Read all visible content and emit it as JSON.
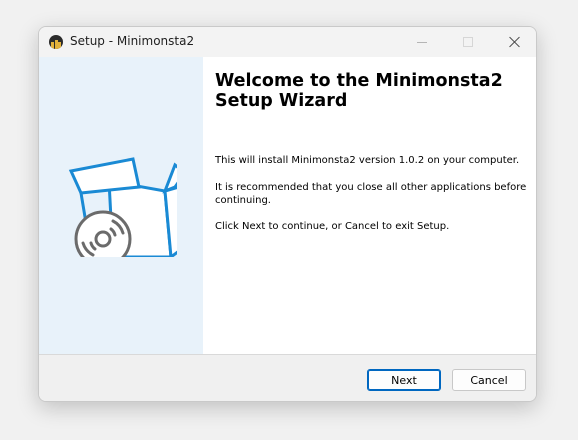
{
  "window": {
    "title": "Setup - Minimonsta2"
  },
  "content": {
    "heading": "Welcome to the Minimonsta2\nSetup Wizard",
    "para1": "This will install Minimonsta2 version 1.0.2 on your computer.",
    "para2": "It is recommended that you close all other applications before\ncontinuing.",
    "para3": "Click Next to continue, or Cancel to exit Setup."
  },
  "footer": {
    "next_label": "Next",
    "cancel_label": "Cancel"
  },
  "icons": {
    "app": "app-icon",
    "art": "software-box-disc-icon",
    "minimize": "minimize-icon",
    "maximize": "maximize-icon",
    "close": "close-icon"
  },
  "colors": {
    "accent": "#0067c0",
    "side_panel": "#e8f2fa",
    "art_blue": "#1a8ad4",
    "art_gray": "#6b6b6b"
  }
}
